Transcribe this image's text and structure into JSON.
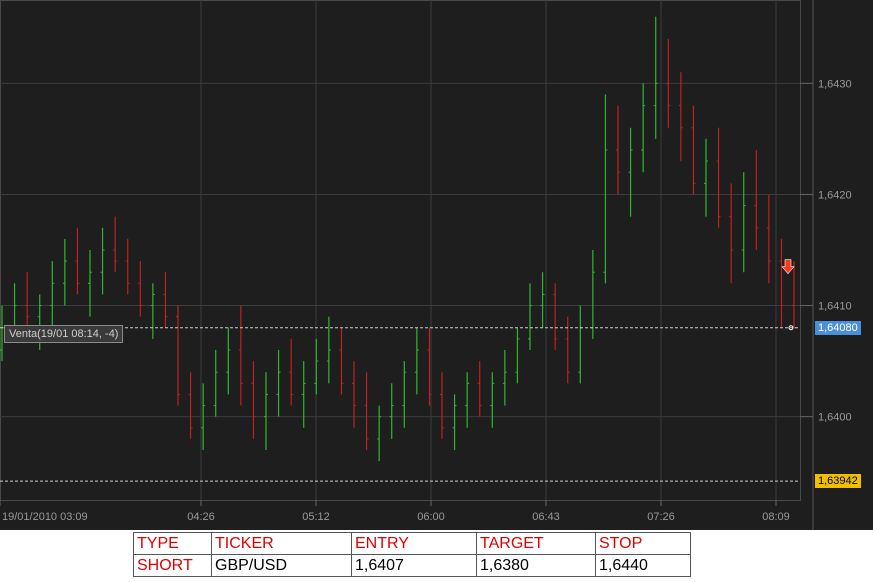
{
  "colors": {
    "background": "#1e1e1e",
    "grid": "#3c3c3c",
    "up": "#2fb82f",
    "down": "#c02020",
    "last_price_bg": "#4a90d9",
    "low_price_bg": "#f0c000",
    "arrow": "#ff3a1a"
  },
  "chart_data": {
    "type": "bar",
    "ylim": [
      1.63925,
      1.64375
    ],
    "yticks": [
      "1,6430",
      "1,6420",
      "1,6410",
      "1,6400"
    ],
    "ytick_values": [
      1.643,
      1.642,
      1.641,
      1.64
    ],
    "xticks": [
      "19/01/2010 03:09",
      "04:26",
      "05:12",
      "06:00",
      "06:43",
      "07:26",
      "08:09"
    ],
    "last_price": "1,64080",
    "last_price_value": 1.6408,
    "low_price": "1,63942",
    "low_price_value": 1.63942,
    "trade_label": "Venta(19/01 08:14, -4)",
    "signal": "sell",
    "series": [
      {
        "ohlc_bars": [
          [
            1.6406,
            1.641,
            1.6405,
            1.6408
          ],
          [
            1.6408,
            1.6412,
            1.6407,
            1.641
          ],
          [
            1.641,
            1.6413,
            1.6407,
            1.6409
          ],
          [
            1.6409,
            1.6411,
            1.6406,
            1.641
          ],
          [
            1.641,
            1.6414,
            1.6408,
            1.6412
          ],
          [
            1.6412,
            1.6416,
            1.641,
            1.6414
          ],
          [
            1.6414,
            1.6417,
            1.6411,
            1.6412
          ],
          [
            1.6412,
            1.6415,
            1.6409,
            1.6413
          ],
          [
            1.6413,
            1.6417,
            1.6411,
            1.6415
          ],
          [
            1.6415,
            1.6418,
            1.6413,
            1.6414
          ],
          [
            1.6414,
            1.6416,
            1.6411,
            1.6412
          ],
          [
            1.6412,
            1.6414,
            1.6409,
            1.641
          ],
          [
            1.641,
            1.6412,
            1.6407,
            1.6411
          ],
          [
            1.6411,
            1.6413,
            1.6408,
            1.6409
          ],
          [
            1.6409,
            1.641,
            1.6401,
            1.6402
          ],
          [
            1.6402,
            1.6404,
            1.6398,
            1.6399
          ],
          [
            1.6399,
            1.6403,
            1.6397,
            1.6401
          ],
          [
            1.6401,
            1.6406,
            1.64,
            1.6404
          ],
          [
            1.6404,
            1.6408,
            1.6402,
            1.6406
          ],
          [
            1.6406,
            1.641,
            1.6401,
            1.6403
          ],
          [
            1.6403,
            1.6405,
            1.6398,
            1.64
          ],
          [
            1.64,
            1.6404,
            1.6397,
            1.6402
          ],
          [
            1.6402,
            1.6406,
            1.64,
            1.6404
          ],
          [
            1.6404,
            1.6407,
            1.6401,
            1.6402
          ],
          [
            1.6402,
            1.6405,
            1.6399,
            1.6403
          ],
          [
            1.6403,
            1.6407,
            1.6402,
            1.6405
          ],
          [
            1.6405,
            1.6409,
            1.6403,
            1.6406
          ],
          [
            1.6406,
            1.6408,
            1.6402,
            1.6403
          ],
          [
            1.6403,
            1.6405,
            1.6399,
            1.6401
          ],
          [
            1.6401,
            1.6404,
            1.6397,
            1.6398
          ],
          [
            1.6398,
            1.6401,
            1.6396,
            1.64
          ],
          [
            1.64,
            1.6403,
            1.6398,
            1.6401
          ],
          [
            1.6401,
            1.6405,
            1.6399,
            1.6404
          ],
          [
            1.6404,
            1.6408,
            1.6402,
            1.6406
          ],
          [
            1.6406,
            1.6408,
            1.6401,
            1.6402
          ],
          [
            1.6402,
            1.6404,
            1.6398,
            1.6399
          ],
          [
            1.6399,
            1.6402,
            1.6397,
            1.6401
          ],
          [
            1.6401,
            1.6404,
            1.6399,
            1.6403
          ],
          [
            1.6403,
            1.6405,
            1.64,
            1.6401
          ],
          [
            1.6401,
            1.6404,
            1.6399,
            1.6403
          ],
          [
            1.6403,
            1.6406,
            1.6401,
            1.6404
          ],
          [
            1.6404,
            1.6408,
            1.6403,
            1.6407
          ],
          [
            1.6407,
            1.6412,
            1.6406,
            1.641
          ],
          [
            1.641,
            1.6413,
            1.6408,
            1.6411
          ],
          [
            1.6411,
            1.6412,
            1.6406,
            1.6407
          ],
          [
            1.6407,
            1.6409,
            1.6403,
            1.6404
          ],
          [
            1.6404,
            1.641,
            1.6403,
            1.6408
          ],
          [
            1.6408,
            1.6415,
            1.6407,
            1.6413
          ],
          [
            1.6413,
            1.6429,
            1.6412,
            1.6424
          ],
          [
            1.6424,
            1.6428,
            1.642,
            1.6422
          ],
          [
            1.6422,
            1.6426,
            1.6418,
            1.6424
          ],
          [
            1.6424,
            1.643,
            1.6422,
            1.6428
          ],
          [
            1.6428,
            1.6436,
            1.6425,
            1.643
          ],
          [
            1.643,
            1.6434,
            1.6426,
            1.6428
          ],
          [
            1.6428,
            1.6431,
            1.6423,
            1.6426
          ],
          [
            1.6426,
            1.6428,
            1.642,
            1.6421
          ],
          [
            1.6421,
            1.6425,
            1.6418,
            1.6423
          ],
          [
            1.6423,
            1.6426,
            1.6417,
            1.6418
          ],
          [
            1.6418,
            1.6421,
            1.6412,
            1.6415
          ],
          [
            1.6415,
            1.6422,
            1.6413,
            1.6419
          ],
          [
            1.6419,
            1.6424,
            1.6415,
            1.6417
          ],
          [
            1.6417,
            1.642,
            1.6412,
            1.6414
          ],
          [
            1.6414,
            1.6416,
            1.6408,
            1.641
          ],
          [
            1.641,
            1.6414,
            1.6408,
            1.6408
          ]
        ]
      }
    ]
  },
  "table": {
    "headers": [
      "TYPE",
      "TICKER",
      "ENTRY",
      "TARGET",
      "STOP"
    ],
    "row": [
      "SHORT",
      "GBP/USD",
      "1,6407",
      "1,6380",
      "1,6440"
    ]
  }
}
